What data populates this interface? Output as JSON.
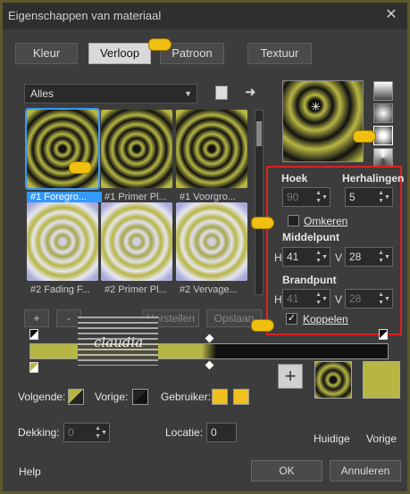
{
  "window": {
    "title": "Eigenschappen van materiaal",
    "close_glyph": "✕"
  },
  "tabs": [
    {
      "label": "Kleur"
    },
    {
      "label": "Verloop"
    },
    {
      "label": "Patroon"
    },
    {
      "label": "Textuur"
    }
  ],
  "library": {
    "dropdown_value": "Alles",
    "items": [
      {
        "label": "#1 Foregro..."
      },
      {
        "label": "#1 Primer Pl..."
      },
      {
        "label": "#1 Voorgro..."
      },
      {
        "label": "#2 Fading F..."
      },
      {
        "label": "#2 Primer Pl..."
      },
      {
        "label": "#2 Vervage..."
      }
    ],
    "add_label": "+",
    "remove_label": "-",
    "reset_label": "Herstellen",
    "save_label": "Opslaan"
  },
  "settings": {
    "angle_label": "Hoek",
    "angle_value": "90",
    "repeats_label": "Herhalingen",
    "repeats_value": "5",
    "invert_label": "Omkeren",
    "center_label": "Middelpunt",
    "center_h_label": "H",
    "center_h": "41",
    "center_v_label": "V",
    "center_v": "28",
    "focus_label": "Brandpunt",
    "focus_h_label": "H",
    "focus_h": "41",
    "focus_v_label": "V",
    "focus_v": "28",
    "link_label": "Koppelen",
    "link_checked": true
  },
  "stops": {
    "next_label": "Volgende:",
    "prev_label": "Vorige:",
    "user_label": "Gebruiker:",
    "opacity_label": "Dekking:",
    "opacity_value": "0",
    "location_label": "Locatie:",
    "location_value": "0"
  },
  "swatches": {
    "current_label": "Huidige",
    "previous_label": "Vorige",
    "add_glyph": "+"
  },
  "footer": {
    "help_label": "Help",
    "ok_label": "OK",
    "cancel_label": "Annuleren"
  },
  "watermark": {
    "text": "claudia"
  },
  "colors": {
    "accent": "#b7b543",
    "selection": "#3399ff",
    "highlight": "#e02020",
    "pointer": "#f0c010"
  }
}
